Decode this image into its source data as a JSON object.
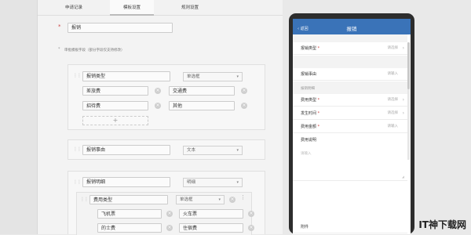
{
  "tabs": [
    "申请记录",
    "模板设置",
    "规则设置"
  ],
  "template_name": "报销",
  "field_hint": "审批模板字段（部分字段仅支持修改）",
  "fields": [
    {
      "name": "报销类型",
      "type": "单选框",
      "options": [
        "差旅费",
        "交通费",
        "招待费",
        "其他"
      ]
    },
    {
      "name": "报销事由",
      "type": "文本"
    },
    {
      "name": "报销明细",
      "type": "明细",
      "sub_name": "费用类型",
      "sub_type": "单选框",
      "sub_options": [
        "飞机票",
        "火车票",
        "的士费",
        "住宿费"
      ]
    }
  ],
  "phone": {
    "back": "返回",
    "title": "报销",
    "rows": [
      {
        "label": "报销类型",
        "required": "*",
        "value": "请选择"
      },
      {
        "label": "报销事由",
        "value": "请输入"
      }
    ],
    "section": "报销明细",
    "detail_rows": [
      {
        "label": "费用类型",
        "required": "*",
        "value": "请选择"
      },
      {
        "label": "发生时间",
        "required": "*",
        "value": "请选择"
      },
      {
        "label": "费用金额",
        "required": "*",
        "value": "请输入"
      }
    ],
    "desc_label": "费用说明",
    "desc_placeholder": "请输入",
    "attachment": "附件"
  },
  "watermark": "IT神下载网"
}
